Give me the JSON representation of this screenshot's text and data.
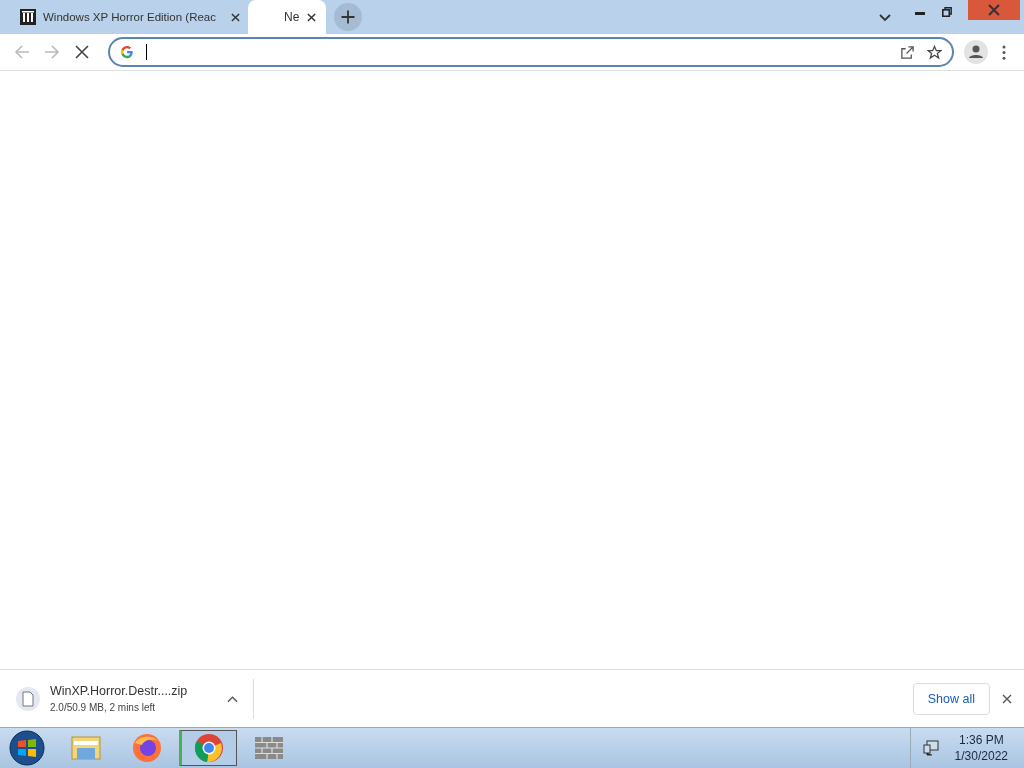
{
  "tabs": [
    {
      "title": "Windows XP Horror Edition (Reac",
      "selected": false,
      "kind": "archive"
    },
    {
      "title": "Ne",
      "selected": true,
      "kind": "loading"
    }
  ],
  "download": {
    "filename": "WinXP.Horror.Destr....zip",
    "status": "2.0/50.9 MB, 2 mins left"
  },
  "show_all": "Show all",
  "taskbar": [
    {
      "kind": "explorer",
      "selected": false
    },
    {
      "kind": "firefox",
      "selected": false
    },
    {
      "kind": "chrome",
      "selected": true
    },
    {
      "kind": "wall",
      "selected": false
    }
  ],
  "clock": {
    "time": "1:36 PM",
    "date": "1/30/2022"
  }
}
